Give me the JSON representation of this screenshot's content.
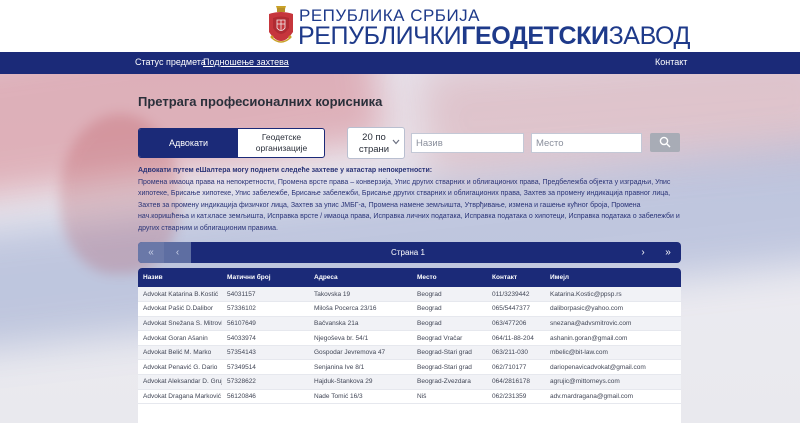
{
  "header": {
    "line1": "РЕПУБЛИКА СРБИЈА",
    "line2_a": "РЕПУБЛИЧКИ",
    "line2_b": "ГЕОДЕТСКИ",
    "line2_c": "ЗАВОД"
  },
  "nav": {
    "items": [
      "Статус предмета",
      "Подношење захтева"
    ],
    "contact": "Контакт"
  },
  "page": {
    "title": "Претрага професионалних корисника"
  },
  "toggle": {
    "lawyers": "Адвокати",
    "geodetic": "Геодетске организације"
  },
  "per_page": {
    "value": "20 по страни"
  },
  "filters": {
    "name_placeholder": "Назив",
    "place_placeholder": "Место"
  },
  "info": {
    "title": "Адвокати путем еШалтера могу поднети следеће захтеве у катастар непокретности:",
    "text": "Промена имаоца права на непокретности, Промена врсте права – конверзија, Упис других стварних и облигационих права, Предбележба објекта у изградњи, Упис хипотеке, Брисање хипотеке, Упис забележбе, Брисање забележби, Брисање других стварних и облигационих права, Захтев за промену индикација правног лица, Захтев за промену индикација физичког лица, Захтев за упис ЈМБГ-а, Промена намене земљишта, Утврђивање, измена и гашење кућног броја, Промена нач.коришћења и кат.класе земљишта, Исправка врсте / имаоца права, Исправка личних података, Исправка података о хипотеци, Исправка података о забележби и других стварним и облигационим правима."
  },
  "pager": {
    "first": "«",
    "prev": "‹",
    "label": "Страна 1",
    "next": "›",
    "last": "»"
  },
  "table": {
    "headers": [
      "Назив",
      "Матични број",
      "Адреса",
      "Место",
      "Контакт",
      "Имејл"
    ],
    "rows": [
      [
        "Advokat Katarina B.Kostić",
        "54031157",
        "Takovska 19",
        "Beograd",
        "011/3239442",
        "Katarina.Kostic@ppsp.rs"
      ],
      [
        "Advokat Pašić D.Dalibor",
        "57336102",
        "Miloša Pocerca 23/16",
        "Beograd",
        "065/5447377",
        "daliborpasic@yahoo.com"
      ],
      [
        "Advokat Snežana S. Mitrović",
        "56107649",
        "Bačvanska 21a",
        "Beograd",
        "063/477206",
        "snezana@advsmitrovic.com"
      ],
      [
        "Advokat Goran Ašanin",
        "54033974",
        "Njegoševa br. 54/1",
        "Beograd Vračar",
        "064/11-88-204",
        "ashanin.goran@gmail.com"
      ],
      [
        "Advokat Belić M. Marko",
        "57354143",
        "Gospodar Jevremova 47",
        "Beograd-Stari grad",
        "063/211-030",
        "mbelic@bit-law.com"
      ],
      [
        "Advokat Penavić G. Dario",
        "57349514",
        "Senjanina Ive 8/1",
        "Beograd-Stari grad",
        "062/710177",
        "dariopenavicadvokat@gmail.com"
      ],
      [
        "Advokat Aleksandar D. Grujić",
        "57328622",
        "Hajduk-Stankova 29",
        "Beograd-Zvezdara",
        "064/2816178",
        "agrujic@mittorneys.com"
      ],
      [
        "Advokat Dragana Marković",
        "56120846",
        "Nade Tomić 16/3",
        "Niš",
        "062/231359",
        "adv.mardragana@gmail.com"
      ]
    ]
  }
}
